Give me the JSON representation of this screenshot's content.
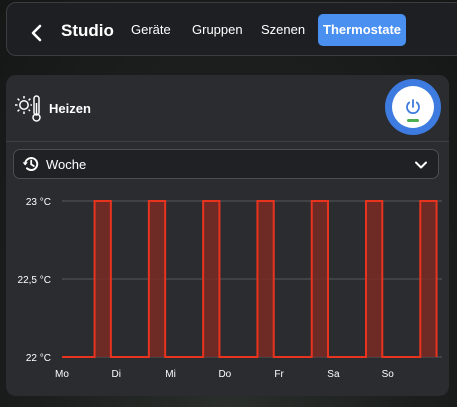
{
  "header": {
    "title": "Studio",
    "tabs": [
      {
        "label": "Geräte",
        "active": false
      },
      {
        "label": "Gruppen",
        "active": false
      },
      {
        "label": "Szenen",
        "active": false
      },
      {
        "label": "Thermostate",
        "active": true
      }
    ]
  },
  "card": {
    "mode_label": "Heizen",
    "power_icon": "power-icon",
    "schedule_select": {
      "value": "Woche"
    }
  },
  "colors": {
    "accent": "#4a90f0",
    "power_ring": "#3d7be0",
    "series_line": "#e8331f",
    "series_fill": "#7a2a22",
    "status_green": "#4caf50"
  },
  "chart_data": {
    "type": "area",
    "ylim": [
      22,
      23
    ],
    "yticks": [
      "23 °C",
      "22,5 °C",
      "22 °C"
    ],
    "ytick_values": [
      23,
      22.5,
      22
    ],
    "xlabels": [
      "Mo",
      "Di",
      "Mi",
      "Do",
      "Fr",
      "Sa",
      "So"
    ],
    "xlim": [
      0,
      7
    ],
    "step": true,
    "grid": true,
    "points": [
      [
        0,
        22
      ],
      [
        0.6,
        22
      ],
      [
        0.6,
        23
      ],
      [
        0.9,
        23
      ],
      [
        0.9,
        22
      ],
      [
        1.6,
        22
      ],
      [
        1.6,
        23
      ],
      [
        1.9,
        23
      ],
      [
        1.9,
        22
      ],
      [
        2.6,
        22
      ],
      [
        2.6,
        23
      ],
      [
        2.9,
        23
      ],
      [
        2.9,
        22
      ],
      [
        3.6,
        22
      ],
      [
        3.6,
        23
      ],
      [
        3.9,
        23
      ],
      [
        3.9,
        22
      ],
      [
        4.6,
        22
      ],
      [
        4.6,
        23
      ],
      [
        4.9,
        23
      ],
      [
        4.9,
        22
      ],
      [
        5.6,
        22
      ],
      [
        5.6,
        23
      ],
      [
        5.9,
        23
      ],
      [
        5.9,
        22
      ],
      [
        6.6,
        22
      ],
      [
        6.6,
        23
      ],
      [
        6.9,
        23
      ],
      [
        6.9,
        22
      ]
    ]
  }
}
